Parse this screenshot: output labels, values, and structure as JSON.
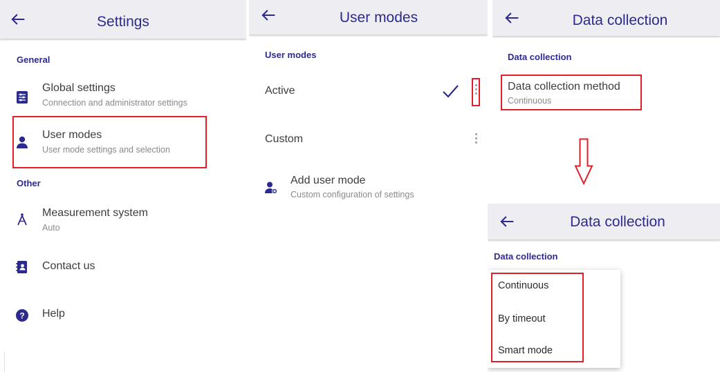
{
  "colors": {
    "accent": "#2c2a8e",
    "highlight": "#e01e2a",
    "appbar": "#eeeef2"
  },
  "settings_panel": {
    "title": "Settings",
    "back_icon": "arrow-left-icon",
    "sections": {
      "general": "General",
      "other": "Other"
    },
    "items": {
      "global": {
        "icon": "sliders-icon",
        "title": "Global settings",
        "subtitle": "Connection and administrator settings"
      },
      "user_modes": {
        "icon": "person-icon",
        "title": "User modes",
        "subtitle": "User mode settings and selection"
      },
      "measurement": {
        "icon": "compass-icon",
        "title": "Measurement system",
        "subtitle": "Auto"
      },
      "contact": {
        "icon": "contact-book-icon",
        "title": "Contact us"
      },
      "help": {
        "icon": "help-circle-icon",
        "title": "Help"
      }
    }
  },
  "user_modes_panel": {
    "title": "User modes",
    "back_icon": "arrow-left-icon",
    "section": "User modes",
    "modes": {
      "active": {
        "label": "Active",
        "icon": "checkmark-icon",
        "menu_icon": "more-vertical-icon"
      },
      "custom": {
        "label": "Custom",
        "menu_icon": "more-vertical-icon"
      }
    },
    "add": {
      "icon": "add-person-icon",
      "title": "Add user mode",
      "subtitle": "Custom configuration of settings"
    }
  },
  "data_collection_panel": {
    "title": "Data collection",
    "back_icon": "arrow-left-icon",
    "section": "Data collection",
    "method": {
      "title": "Data collection method",
      "value": "Continuous"
    }
  },
  "arrow_icon": "arrow-down-outline-icon",
  "data_collection_dropdown_panel": {
    "title": "Data collection",
    "back_icon": "arrow-left-icon",
    "section": "Data collection",
    "options": [
      "Continuous",
      "By timeout",
      "Smart mode"
    ]
  }
}
